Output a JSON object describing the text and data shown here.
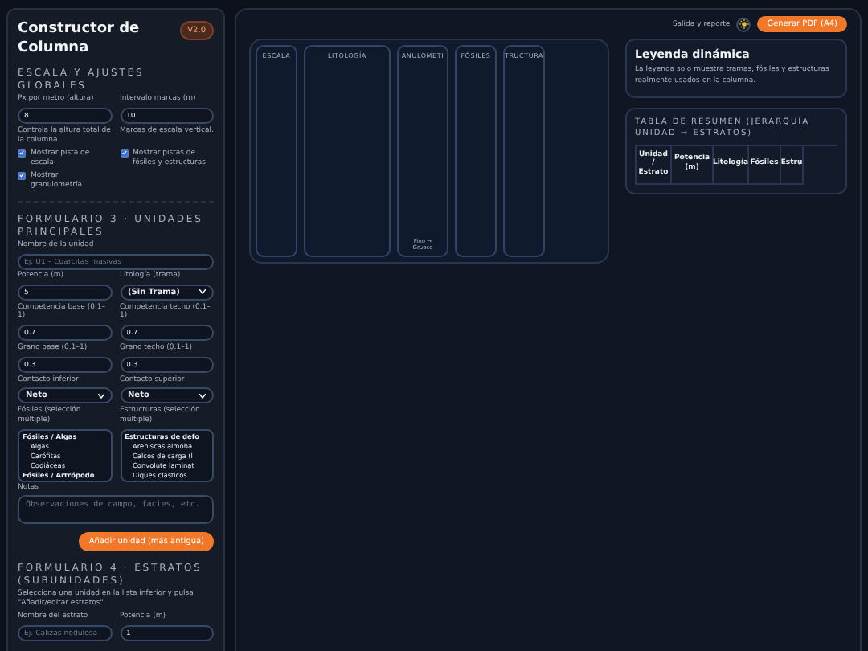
{
  "sidebar": {
    "title": "Constructor de Columna",
    "version": "V2.0"
  },
  "global_settings": {
    "heading": "ESCALA Y AJUSTES GLOBALES",
    "fields": [
      {
        "label": "Px por metro (altura)",
        "value": "8",
        "hint": "Controla la altura total de la columna."
      },
      {
        "label": "Intervalo marcas (m)",
        "value": "10",
        "hint": "Marcas de escala vertical."
      }
    ],
    "checkboxes": [
      {
        "label": "Mostrar pista de escala",
        "checked": true
      },
      {
        "label": "Mostrar pistas de fósiles y estructuras",
        "checked": true
      },
      {
        "label": "Mostrar granulometría",
        "checked": true
      }
    ]
  },
  "units_form": {
    "heading": "FORMULARIO 3 · UNIDADES PRINCIPALES",
    "name_field": {
      "kind": "input",
      "label": "Nombre de la unidad",
      "placeholder": "Ej. U1 – Cuarcitas masivas"
    },
    "fields": [
      {
        "kind": "input",
        "label": "Potencia (m)",
        "value": "5"
      },
      {
        "kind": "select",
        "label": "Litología (trama)",
        "value": "(Sin Trama)"
      },
      {
        "kind": "input",
        "label": "Competencia base (0.1–1)",
        "value": "0.7"
      },
      {
        "kind": "input",
        "label": "Competencia techo (0.1–1)",
        "value": "0.7"
      },
      {
        "kind": "input",
        "label": "Grano base (0.1–1)",
        "value": "0.3"
      },
      {
        "kind": "input",
        "label": "Grano techo (0.1–1)",
        "value": "0.3"
      },
      {
        "kind": "select",
        "label": "Contacto inferior",
        "value": "Neto"
      },
      {
        "kind": "select",
        "label": "Contacto superior",
        "value": "Neto"
      }
    ],
    "lists": [
      {
        "label": "Fósiles (selección múltiple)",
        "items": [
          {
            "kind": "group",
            "text": "Fósiles / Algas"
          },
          {
            "kind": "item",
            "text": "Algas"
          },
          {
            "kind": "item",
            "text": "Carófitas"
          },
          {
            "kind": "item",
            "text": "Codiáceas"
          },
          {
            "kind": "group",
            "text": "Fósiles / Artrópodo"
          }
        ]
      },
      {
        "label": "Estructuras (selección múltiple)",
        "items": [
          {
            "kind": "group",
            "text": "Estructuras de defo"
          },
          {
            "kind": "item",
            "text": "Areniscas almoha"
          },
          {
            "kind": "item",
            "text": "Calcos de carga (l"
          },
          {
            "kind": "item",
            "text": "Convolute laminat"
          },
          {
            "kind": "item",
            "text": "Diques clásticos"
          }
        ]
      }
    ],
    "notes": {
      "label": "Notas",
      "placeholder": "Observaciones de campo, facies, etc."
    },
    "button": "Añadir unidad (más antigua)"
  },
  "strata_form": {
    "heading": "FORMULARIO 4 · ESTRATOS (SUBUNIDADES)",
    "description": "Selecciona una unidad en la lista inferior y pulsa \"Añadir/editar estratos\".",
    "fields": [
      {
        "kind": "input",
        "label": "Nombre del estrato",
        "placeholder": "Ej. Calizas nodulosa"
      },
      {
        "kind": "input",
        "label": "Potencia (m)",
        "value": "1"
      }
    ]
  },
  "toolbar": {
    "label": "Salida y reporte",
    "button": "Generar PDF (A4)"
  },
  "columns": [
    {
      "title": "ESCALA",
      "kind": "narrow"
    },
    {
      "title": "LITOLOGÍA",
      "kind": "wide"
    },
    {
      "title": "ANULOMETI",
      "kind": "medium",
      "footer": "Fino → Grueso"
    },
    {
      "title": "FÓSILES",
      "kind": "narrow"
    },
    {
      "title": "TRUCTURA",
      "kind": "narrow"
    }
  ],
  "legend": {
    "title": "Leyenda dinámica",
    "description": "La leyenda solo muestra tramas, fósiles y estructuras realmente usados en la columna."
  },
  "summary_table": {
    "title": "TABLA DE RESUMEN (JERARQUÍA UNIDAD → ESTRATOS)",
    "columns": [
      "Unidad / Estrato",
      "Potencia (m)",
      "Litología",
      "Fósiles",
      "Estru"
    ]
  }
}
